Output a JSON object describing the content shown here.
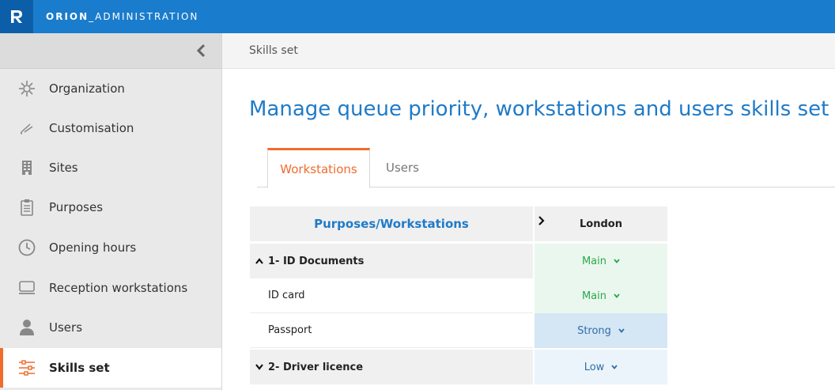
{
  "header": {
    "app_title_bold": "ORION",
    "app_title_rest": "_ADMINISTRATION",
    "logo_icon": "orion-logo",
    "colors": {
      "topbar": "#1a7ccc",
      "logo_bg": "#0d5ea8",
      "accent": "#ef6c2d",
      "title_blue": "#1f7bc8"
    }
  },
  "sidebar": {
    "collapse_icon": "chevron-left-icon",
    "items": [
      {
        "label": "Organization",
        "icon": "network-icon"
      },
      {
        "label": "Customisation",
        "icon": "brush-icon"
      },
      {
        "label": "Sites",
        "icon": "building-icon"
      },
      {
        "label": "Purposes",
        "icon": "clipboard-icon"
      },
      {
        "label": "Opening hours",
        "icon": "clock-icon"
      },
      {
        "label": "Reception workstations",
        "icon": "monitor-icon"
      },
      {
        "label": "Users",
        "icon": "user-icon"
      },
      {
        "label": "Skills set",
        "icon": "sliders-icon",
        "active": true
      }
    ]
  },
  "breadcrumb": "Skills set",
  "main": {
    "title": "Manage queue priority, workstations and users skills set",
    "tabs": [
      {
        "label": "Workstations",
        "active": true
      },
      {
        "label": "Users",
        "active": false
      }
    ],
    "table": {
      "header_col1": "Purposes/Workstations",
      "header_col2": "London",
      "rows": [
        {
          "type": "group",
          "label": "1- ID Documents",
          "expanded": true,
          "level": "Main",
          "level_color": "#2aa84a",
          "bg": "#eaf7ee"
        },
        {
          "type": "item",
          "label": "ID card",
          "level": "Main",
          "level_color": "#2aa84a",
          "bg": "#eaf7ee"
        },
        {
          "type": "item",
          "label": "Passport",
          "level": "Strong",
          "level_color": "#2f6fa8",
          "bg": "#d5e6f5"
        },
        {
          "type": "group",
          "label": "2- Driver licence",
          "expanded": false,
          "level": "Low",
          "level_color": "#2f6fa8",
          "bg": "#ecf4fb"
        }
      ]
    }
  }
}
